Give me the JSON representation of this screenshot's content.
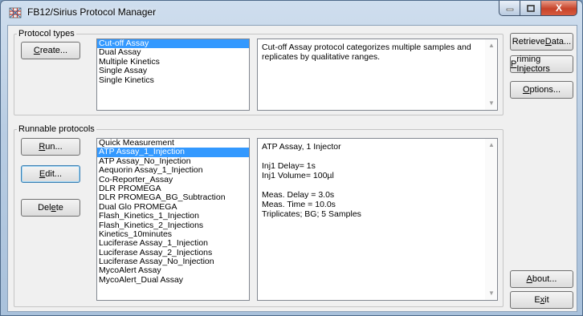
{
  "window": {
    "title": "FB12/Sirius Protocol Manager",
    "icon": "grid-app-icon",
    "controls": {
      "minimize": "minimize",
      "maximize": "maximize",
      "close": "X"
    }
  },
  "protocol_types": {
    "label": "Protocol types",
    "create_button": {
      "pre": "",
      "u": "C",
      "post": "reate..."
    },
    "items": [
      "Cut-off Assay",
      "Dual Assay",
      "Multiple Kinetics",
      "Single Assay",
      "Single Kinetics"
    ],
    "selected_index": 0,
    "description": "Cut-off Assay protocol categorizes multiple samples and replicates by qualitative ranges."
  },
  "runnable": {
    "label": "Runnable protocols",
    "run_button": {
      "pre": "",
      "u": "R",
      "post": "un..."
    },
    "edit_button": {
      "pre": "",
      "u": "E",
      "post": "dit..."
    },
    "delete_button": {
      "pre": "Del",
      "u": "e",
      "post": "te"
    },
    "items": [
      "Quick Measurement",
      "ATP Assay_1_Injection",
      "ATP Assay_No_Injection",
      "Aequorin Assay_1_Injection",
      "Co-Reporter_Assay",
      "DLR PROMEGA",
      "DLR PROMEGA_BG_Subtraction",
      "Dual Glo PROMEGA",
      "Flash_Kinetics_1_Injection",
      "Flash_Kinetics_2_Injections",
      "Kinetics_10minutes",
      "Luciferase Assay_1_Injection",
      "Luciferase Assay_2_Injections",
      "Luciferase Assay_No_Injection",
      "MycoAlert Assay",
      "MycoAlert_Dual Assay"
    ],
    "selected_index": 1,
    "details": [
      "ATP Assay, 1 Injector",
      "",
      "Inj1 Delay= 1s",
      "Inj1 Volume= 100µl",
      "",
      "Meas. Delay = 3.0s",
      "Meas. Time = 10.0s",
      "Triplicates; BG; 5 Samples"
    ]
  },
  "side_buttons": {
    "retrieve": {
      "pre": "Retrieve ",
      "u": "D",
      "post": "ata..."
    },
    "priming": {
      "pre": "",
      "u": "P",
      "post": "riming Injectors"
    },
    "options": {
      "pre": "",
      "u": "O",
      "post": "ptions..."
    },
    "about": {
      "pre": "",
      "u": "A",
      "post": "bout..."
    },
    "exit": {
      "pre": "E",
      "u": "x",
      "post": "it"
    }
  }
}
